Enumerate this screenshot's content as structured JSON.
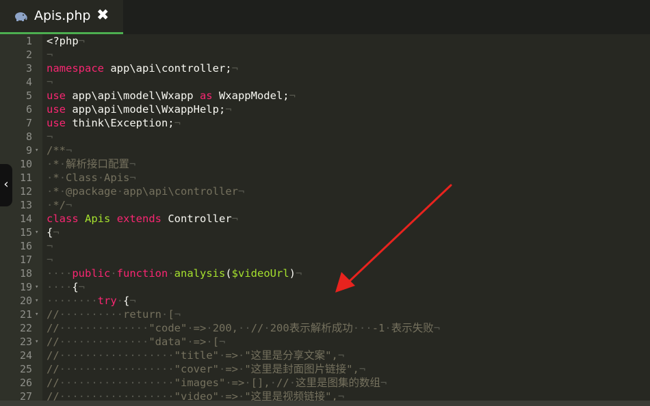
{
  "tab": {
    "label": "Apis.php",
    "close": "✖",
    "icon": "php-elephant-icon"
  },
  "collapse_label": "‹",
  "lines": [
    {
      "n": "1",
      "fold": false,
      "html": "&lt;?php<span class=\"inv\">¬</span>"
    },
    {
      "n": "2",
      "fold": false,
      "html": "<span class=\"inv\">¬</span>"
    },
    {
      "n": "3",
      "fold": false,
      "html": "<span class=\"kw\">namespace</span> app\\api\\controller;<span class=\"inv\">¬</span>"
    },
    {
      "n": "4",
      "fold": false,
      "html": "<span class=\"inv\">¬</span>"
    },
    {
      "n": "5",
      "fold": false,
      "html": "<span class=\"kw\">use</span> app\\api\\model\\Wxapp <span class=\"kw\">as</span> WxappModel;<span class=\"inv\">¬</span>"
    },
    {
      "n": "6",
      "fold": false,
      "html": "<span class=\"kw\">use</span> app\\api\\model\\WxappHelp;<span class=\"inv\">¬</span>"
    },
    {
      "n": "7",
      "fold": false,
      "html": "<span class=\"kw\">use</span> think\\Exception;<span class=\"inv\">¬</span>"
    },
    {
      "n": "8",
      "fold": false,
      "html": "<span class=\"inv\">¬</span>"
    },
    {
      "n": "9",
      "fold": true,
      "html": "<span class=\"cm\">/**</span><span class=\"inv\">¬</span>"
    },
    {
      "n": "10",
      "fold": false,
      "html": "<span class=\"inv\">·</span><span class=\"cm\">*</span><span class=\"inv\">·</span><span class=\"cm\">解析接口配置</span><span class=\"inv\">¬</span>"
    },
    {
      "n": "11",
      "fold": false,
      "html": "<span class=\"inv\">·</span><span class=\"cm\">*</span><span class=\"inv\">·</span><span class=\"cm\">Class</span><span class=\"inv\">·</span><span class=\"cm\">Apis</span><span class=\"inv\">¬</span>"
    },
    {
      "n": "12",
      "fold": false,
      "html": "<span class=\"inv\">·</span><span class=\"cm\">*</span><span class=\"inv\">·</span><span class=\"cm\">@package</span><span class=\"inv\">·</span><span class=\"cm\">app\\api\\controller</span><span class=\"inv\">¬</span>"
    },
    {
      "n": "13",
      "fold": false,
      "html": "<span class=\"inv\">·</span><span class=\"cm\">*/</span><span class=\"inv\">¬</span>"
    },
    {
      "n": "14",
      "fold": false,
      "html": "<span class=\"kw\">class</span> <span class=\"cls\">Apis</span> <span class=\"kw\">extends</span> Controller<span class=\"inv\">¬</span>"
    },
    {
      "n": "15",
      "fold": true,
      "html": "{<span class=\"inv\">¬</span>"
    },
    {
      "n": "16",
      "fold": false,
      "html": "<span class=\"inv\">¬</span>"
    },
    {
      "n": "17",
      "fold": false,
      "html": "<span class=\"inv\">¬</span>"
    },
    {
      "n": "18",
      "fold": false,
      "html": "<span class=\"inv\">····</span><span class=\"kw\">public</span><span class=\"inv\">·</span><span class=\"kw\">function</span><span class=\"inv\">·</span><span class=\"cls\">analysis</span>(<span class=\"var\">$videoUrl</span>)<span class=\"inv\">¬</span>"
    },
    {
      "n": "19",
      "fold": true,
      "html": "<span class=\"inv\">····</span>{<span class=\"inv\">¬</span>"
    },
    {
      "n": "20",
      "fold": true,
      "html": "<span class=\"inv\">········</span><span class=\"kw\">try</span><span class=\"inv\">·</span>{<span class=\"inv\">¬</span>"
    },
    {
      "n": "21",
      "fold": true,
      "html": "<span class=\"cm\">//</span><span class=\"inv\">··········</span><span class=\"cm\">return</span><span class=\"inv\">·</span><span class=\"cm\">[</span><span class=\"inv\">¬</span>"
    },
    {
      "n": "22",
      "fold": false,
      "html": "<span class=\"cm\">//</span><span class=\"inv\">··············</span><span class=\"cm\">\"code\"</span><span class=\"inv\">·</span><span class=\"cm\">=&gt;</span><span class=\"inv\">·</span><span class=\"cm\">200,</span><span class=\"inv\">··</span><span class=\"cm\">//</span><span class=\"inv\">·</span><span class=\"cm\">200表示解析成功</span><span class=\"inv\">···</span><span class=\"cm\">-1</span><span class=\"inv\">·</span><span class=\"cm\">表示失败</span><span class=\"inv\">¬</span>"
    },
    {
      "n": "23",
      "fold": true,
      "html": "<span class=\"cm\">//</span><span class=\"inv\">··············</span><span class=\"cm\">\"data\"</span><span class=\"inv\">·</span><span class=\"cm\">=&gt;</span><span class=\"inv\">·</span><span class=\"cm\">[</span><span class=\"inv\">¬</span>"
    },
    {
      "n": "24",
      "fold": false,
      "html": "<span class=\"cm\">//</span><span class=\"inv\">··················</span><span class=\"cm\">\"title\"</span><span class=\"inv\">·</span><span class=\"cm\">=&gt;</span><span class=\"inv\">·</span><span class=\"cm\">\"这里是分享文案\",</span><span class=\"inv\">¬</span>"
    },
    {
      "n": "25",
      "fold": false,
      "html": "<span class=\"cm\">//</span><span class=\"inv\">··················</span><span class=\"cm\">\"cover\"</span><span class=\"inv\">·</span><span class=\"cm\">=&gt;</span><span class=\"inv\">·</span><span class=\"cm\">\"这里是封面图片链接\",</span><span class=\"inv\">¬</span>"
    },
    {
      "n": "26",
      "fold": false,
      "html": "<span class=\"cm\">//</span><span class=\"inv\">··················</span><span class=\"cm\">\"images\"</span><span class=\"inv\">·</span><span class=\"cm\">=&gt;</span><span class=\"inv\">·</span><span class=\"cm\">[],</span><span class=\"inv\">·</span><span class=\"cm\">//</span><span class=\"inv\">·</span><span class=\"cm\">这里是图集的数组</span><span class=\"inv\">¬</span>"
    },
    {
      "n": "27",
      "fold": false,
      "html": "<span class=\"cm\">//</span><span class=\"inv\">··················</span><span class=\"cm\">\"video\"</span><span class=\"inv\">·</span><span class=\"cm\">=&gt;</span><span class=\"inv\">·</span><span class=\"cm\">\"这里是视频链接\",</span><span class=\"inv\">¬</span>"
    }
  ],
  "colors": {
    "background": "#272822",
    "gutter": "#2f3129",
    "tab_underline": "#4caf50",
    "keyword": "#f92672",
    "class_name": "#a6e22e",
    "comment": "#75715e",
    "arrow": "#e8231e"
  }
}
